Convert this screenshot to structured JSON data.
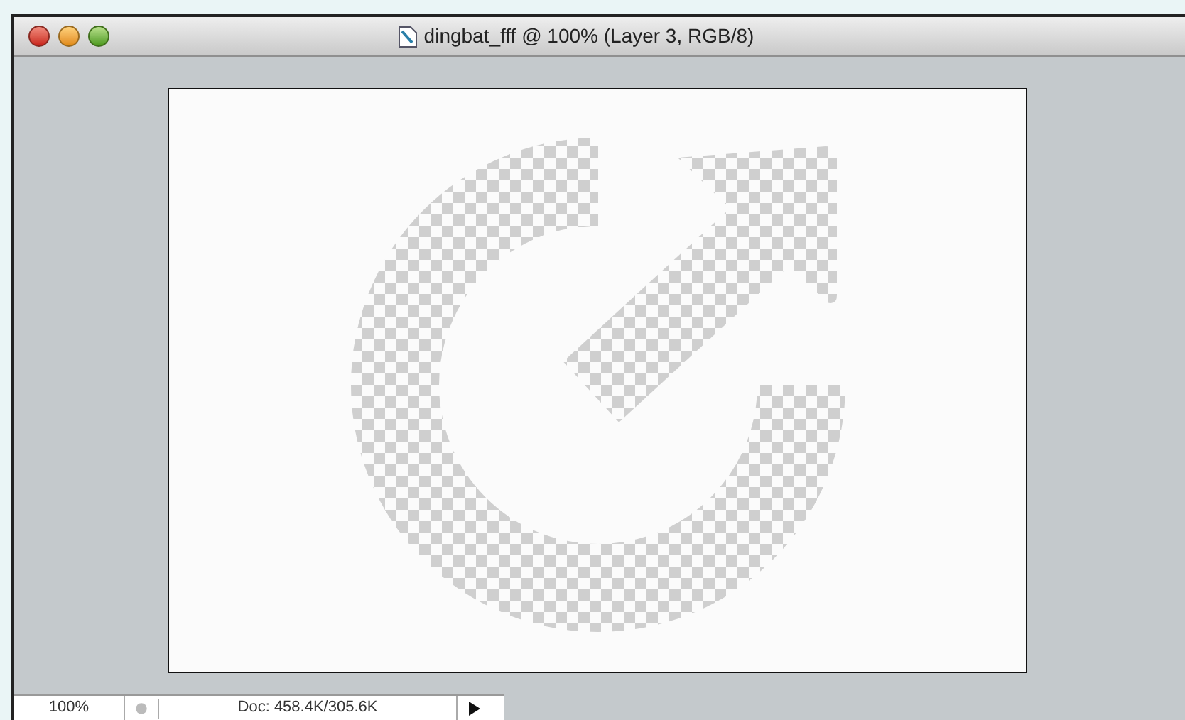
{
  "window": {
    "title": "dingbat_fff @ 100% (Layer 3, RGB/8)"
  },
  "status_bar": {
    "zoom": "100%",
    "doc_info": "Doc: 458.4K/305.6K"
  }
}
